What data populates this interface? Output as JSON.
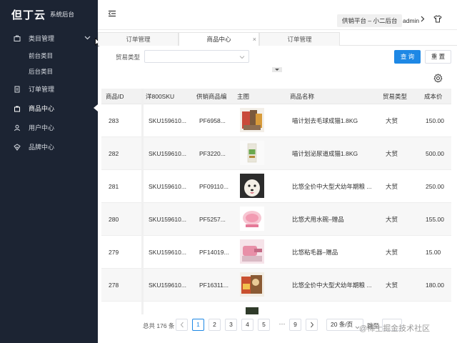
{
  "brand": {
    "logo": "但丁云",
    "subtitle": "系统后台"
  },
  "sidebar": {
    "items": [
      {
        "label": "类目管理"
      },
      {
        "label": "前台类目"
      },
      {
        "label": "后台类目"
      },
      {
        "label": "订单管理"
      },
      {
        "label": "商品中心"
      },
      {
        "label": "用户中心"
      },
      {
        "label": "品牌中心"
      }
    ]
  },
  "header": {
    "platform": "供销平台 – 小二后台",
    "user": "admin"
  },
  "tabs": [
    {
      "label": "订单管理"
    },
    {
      "label": "商品中心",
      "close": "×"
    },
    {
      "label": "订单管理"
    }
  ],
  "filter": {
    "trade_type_label": "贸易类型",
    "query_button": "查 询",
    "reset_button": "重 置"
  },
  "table": {
    "columns": [
      "商品ID",
      "洋800SKU",
      "供销商品编",
      "主图",
      "商品名称",
      "贸易类型",
      "成本价"
    ],
    "rows": [
      {
        "id": "283",
        "sku": "SKU159610...",
        "code": "PF6958...",
        "name": "喵计划去毛球成猫1.8KG",
        "trade": "大贸",
        "cost": "150.00"
      },
      {
        "id": "282",
        "sku": "SKU159610...",
        "code": "PF3220...",
        "name": "喵计划泌尿道成猫1.8KG",
        "trade": "大贸",
        "cost": "500.00"
      },
      {
        "id": "281",
        "sku": "SKU159610...",
        "code": "PF09110...",
        "name": "比悠全价中大型犬幼年期粮 ...",
        "trade": "大贸",
        "cost": "250.00"
      },
      {
        "id": "280",
        "sku": "SKU159610...",
        "code": "PF5257...",
        "name": "比悠犬用水碗–赠品",
        "trade": "大贸",
        "cost": "155.00"
      },
      {
        "id": "279",
        "sku": "SKU159610...",
        "code": "PF14019...",
        "name": "比悠粘毛器–赠品",
        "trade": "大贸",
        "cost": "15.00"
      },
      {
        "id": "278",
        "sku": "SKU159610...",
        "code": "PF16311...",
        "name": "比悠全价中大型犬幼年期粮 ...",
        "trade": "大贸",
        "cost": "180.00"
      }
    ]
  },
  "pagination": {
    "total": "总共 176 条",
    "pages": [
      "1",
      "2",
      "3",
      "4",
      "5"
    ],
    "ellipsis": "···",
    "last_page": "9",
    "page_size": "20 条/页",
    "goto": "跳至",
    "current": 1
  },
  "watermark": "@稀土掘金技术社区",
  "colors": {
    "sidebar_bg": "#1c2433",
    "primary": "#1e88e5"
  }
}
